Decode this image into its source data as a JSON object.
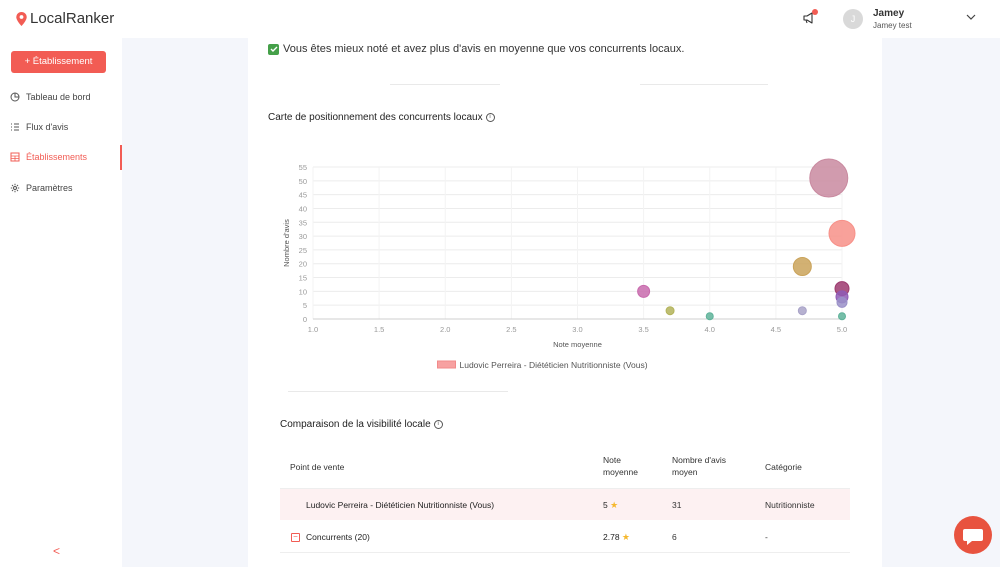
{
  "header": {
    "brand_part1": "Local",
    "brand_part2": "Ranker",
    "user_initial": "J",
    "user_name": "Jamey",
    "user_subtitle": "Jamey test"
  },
  "sidebar": {
    "add_button": "+ Établissement",
    "items": [
      {
        "label": "Tableau de bord",
        "icon": "dashboard-icon"
      },
      {
        "label": "Flux d'avis",
        "icon": "list-icon"
      },
      {
        "label": "Établissements",
        "icon": "building-icon",
        "active": true
      },
      {
        "label": "Paramètres",
        "icon": "gear-icon"
      }
    ],
    "collapse": "<"
  },
  "main": {
    "insight_text": "Vous êtes mieux noté et avez plus d'avis en moyenne que vos concurrents locaux.",
    "map_title": "Carte de positionnement des concurrents locaux",
    "visibility_title": "Comparaison de la visibilité locale"
  },
  "chart_data": {
    "type": "scatter",
    "xlabel": "Note moyenne",
    "ylabel": "Nombre d'avis",
    "xlim": [
      1.0,
      5.0
    ],
    "ylim": [
      0,
      55
    ],
    "x_ticks": [
      "1.0",
      "1.5",
      "2.0",
      "2.5",
      "3.0",
      "3.5",
      "4.0",
      "4.5",
      "5.0"
    ],
    "y_ticks": [
      "0",
      "5",
      "10",
      "15",
      "20",
      "25",
      "30",
      "35",
      "40",
      "45",
      "50",
      "55"
    ],
    "grid": true,
    "legend": [
      {
        "name": "Ludovic Perreira - Diététicien Nutritionniste (Vous)",
        "color": "#f7a1a1"
      }
    ],
    "points": [
      {
        "x": 4.9,
        "y": 51,
        "r": 19,
        "color": "#c98aa0"
      },
      {
        "x": 5.0,
        "y": 31,
        "r": 13,
        "color": "#f79088"
      },
      {
        "x": 4.7,
        "y": 19,
        "r": 9,
        "color": "#caa35a"
      },
      {
        "x": 5.0,
        "y": 11,
        "r": 7,
        "color": "#9c3a6e"
      },
      {
        "x": 3.5,
        "y": 10,
        "r": 6,
        "color": "#c86aad"
      },
      {
        "x": 5.0,
        "y": 8,
        "r": 6,
        "color": "#8e5ab5"
      },
      {
        "x": 5.0,
        "y": 6,
        "r": 5,
        "color": "#9a90c8"
      },
      {
        "x": 3.7,
        "y": 3,
        "r": 4,
        "color": "#b3b35a"
      },
      {
        "x": 4.7,
        "y": 3,
        "r": 4,
        "color": "#a9a3c8"
      },
      {
        "x": 4.0,
        "y": 1,
        "r": 3.5,
        "color": "#5fb39a"
      },
      {
        "x": 5.0,
        "y": 1,
        "r": 3.5,
        "color": "#5fb39a"
      }
    ]
  },
  "table": {
    "headers": {
      "point": "Point de vente",
      "note_l1": "Note",
      "note_l2": "moyenne",
      "avis_l1": "Nombre d'avis",
      "avis_l2": "moyen",
      "cat": "Catégorie"
    },
    "rows": [
      {
        "name": "Ludovic Perreira - Diététicien Nutritionniste (Vous)",
        "note": "5",
        "avis": "31",
        "cat": "Nutritionniste"
      },
      {
        "name": "Concurrents (20)",
        "note": "2.78",
        "avis": "6",
        "cat": "-"
      }
    ]
  },
  "colors": {
    "accent": "#f25c54",
    "success": "#45a049",
    "star": "#f5b82e"
  }
}
